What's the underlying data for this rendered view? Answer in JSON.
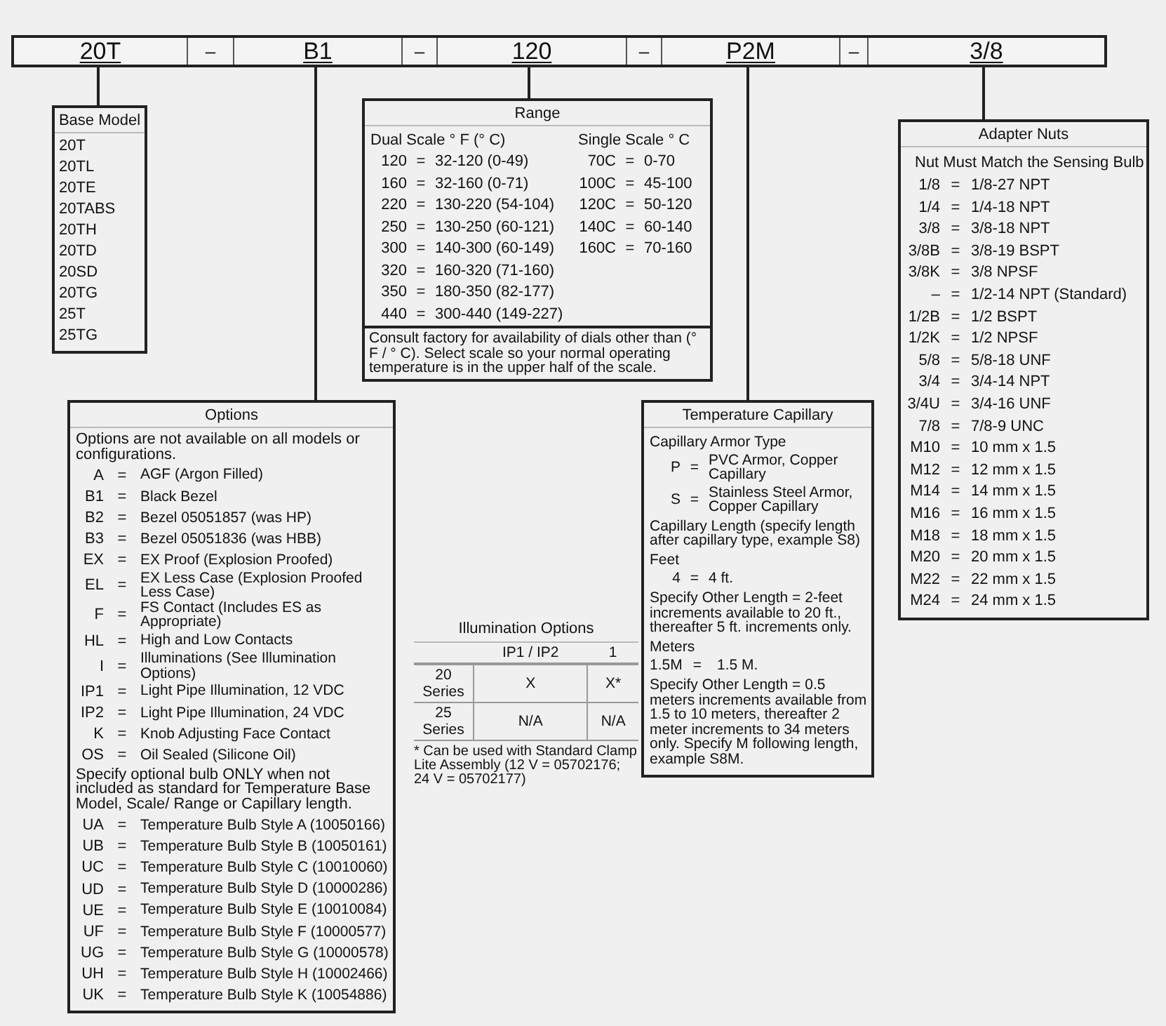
{
  "part_number": {
    "segments": [
      {
        "kind": "code",
        "text": "20T"
      },
      {
        "kind": "separator",
        "text": "–"
      },
      {
        "kind": "code",
        "text": "B1"
      },
      {
        "kind": "separator",
        "text": "–"
      },
      {
        "kind": "code",
        "text": "120"
      },
      {
        "kind": "separator",
        "text": "–"
      },
      {
        "kind": "code",
        "text": "P2M"
      },
      {
        "kind": "separator",
        "text": "–"
      },
      {
        "kind": "code",
        "text": "3/8"
      }
    ]
  },
  "base_model": {
    "title": "Base Model",
    "items": [
      "20T",
      "20TL",
      "20TE",
      "20TABS",
      "20TH",
      "20TD",
      "20SD",
      "20TG",
      "25T",
      "25TG"
    ]
  },
  "range": {
    "title": "Range",
    "dual_scale": {
      "heading": "Dual Scale ° F (° C)",
      "rows": [
        {
          "code": "120",
          "eq": "=",
          "value": "32-120 (0-49)"
        },
        {
          "code": "160",
          "eq": "=",
          "value": "32-160 (0-71)"
        },
        {
          "code": "220",
          "eq": "=",
          "value": "130-220 (54-104)"
        },
        {
          "code": "250",
          "eq": "=",
          "value": "130-250 (60-121)"
        },
        {
          "code": "300",
          "eq": "=",
          "value": "140-300 (60-149)"
        },
        {
          "code": "320",
          "eq": "=",
          "value": "160-320 (71-160)"
        },
        {
          "code": "350",
          "eq": "=",
          "value": "180-350 (82-177)"
        },
        {
          "code": "440",
          "eq": "=",
          "value": "300-440 (149-227)"
        }
      ]
    },
    "single_scale": {
      "heading": "Single Scale ° C",
      "rows": [
        {
          "code": "70C",
          "eq": "=",
          "value": "0-70"
        },
        {
          "code": "100C",
          "eq": "=",
          "value": "45-100"
        },
        {
          "code": "120C",
          "eq": "=",
          "value": "50-120"
        },
        {
          "code": "140C",
          "eq": "=",
          "value": "60-140"
        },
        {
          "code": "160C",
          "eq": "=",
          "value": "70-160"
        }
      ]
    },
    "note": "Consult factory for availability of dials other than (° F / ° C). Select scale so your normal operating temperature is in the upper half of the scale."
  },
  "options": {
    "title": "Options",
    "entries": [
      {
        "kind": "note",
        "text": "Options are not available on all models or configurations."
      },
      {
        "kind": "row",
        "code": "A",
        "eq": "=",
        "value": "AGF (Argon Filled)"
      },
      {
        "kind": "row",
        "code": "B1",
        "eq": "=",
        "value": "Black Bezel"
      },
      {
        "kind": "row",
        "code": "B2",
        "eq": "=",
        "value": "Bezel 05051857 (was HP)"
      },
      {
        "kind": "row",
        "code": "B3",
        "eq": "=",
        "value": "Bezel 05051836 (was HBB)"
      },
      {
        "kind": "row",
        "code": "EX",
        "eq": "=",
        "value": "EX Proof (Explosion Proofed)"
      },
      {
        "kind": "row",
        "code": "EL",
        "eq": "=",
        "value": "EX Less Case (Explosion Proofed Less Case)"
      },
      {
        "kind": "row",
        "code": "F",
        "eq": "=",
        "value": "FS Contact (Includes ES as Appropriate)"
      },
      {
        "kind": "row",
        "code": "HL",
        "eq": "=",
        "value": "High and Low Contacts"
      },
      {
        "kind": "row",
        "code": "I",
        "eq": "=",
        "value": "Illuminations (See Illumination Options)"
      },
      {
        "kind": "row",
        "code": "IP1",
        "eq": "=",
        "value": "Light Pipe Illumination, 12 VDC"
      },
      {
        "kind": "row",
        "code": "IP2",
        "eq": "=",
        "value": "Light Pipe Illumination, 24 VDC"
      },
      {
        "kind": "row",
        "code": "K",
        "eq": "=",
        "value": "Knob Adjusting Face Contact"
      },
      {
        "kind": "row",
        "code": "OS",
        "eq": "=",
        "value": "Oil Sealed (Silicone Oil)"
      },
      {
        "kind": "note",
        "text": "Specify optional bulb ONLY when not included as standard for Temperature Base Model, Scale/ Range or Capillary length."
      },
      {
        "kind": "row",
        "code": "UA",
        "eq": "=",
        "value": "Temperature Bulb Style A (10050166)"
      },
      {
        "kind": "row",
        "code": "UB",
        "eq": "=",
        "value": "Temperature Bulb Style B (10050161)"
      },
      {
        "kind": "row",
        "code": "UC",
        "eq": "=",
        "value": "Temperature Bulb Style C (10010060)"
      },
      {
        "kind": "row",
        "code": "UD",
        "eq": "=",
        "value": "Temperature Bulb Style D (10000286)"
      },
      {
        "kind": "row",
        "code": "UE",
        "eq": "=",
        "value": "Temperature Bulb Style E (10010084)"
      },
      {
        "kind": "row",
        "code": "UF",
        "eq": "=",
        "value": "Temperature Bulb Style F (10000577)"
      },
      {
        "kind": "row",
        "code": "UG",
        "eq": "=",
        "value": "Temperature Bulb Style G (10000578)"
      },
      {
        "kind": "row",
        "code": "UH",
        "eq": "=",
        "value": "Temperature Bulb Style H (10002466)"
      },
      {
        "kind": "row",
        "code": "UK",
        "eq": "=",
        "value": "Temperature Bulb Style K (10054886)"
      }
    ]
  },
  "illumination_options": {
    "title": "Illumination Options",
    "columns": [
      "IP1 / IP2",
      "1"
    ],
    "rows": [
      {
        "label": "20 Series",
        "cells": [
          "X",
          "X*"
        ]
      },
      {
        "label": "25 Series",
        "cells": [
          "N/A",
          "N/A"
        ]
      }
    ],
    "footnote": "* Can be used with Standard Clamp Lite Assembly (12 V = 05702176; 24 V = 05702177)"
  },
  "temperature_capillary": {
    "title": "Temperature Capillary",
    "entries": [
      {
        "kind": "heading",
        "text": "Capillary Armor Type"
      },
      {
        "kind": "row",
        "code": "P",
        "eq": "=",
        "value": "PVC Armor, Copper Capillary"
      },
      {
        "kind": "row",
        "code": "S",
        "eq": "=",
        "value": "Stainless Steel Armor, Copper Capillary"
      },
      {
        "kind": "heading",
        "text": "Capillary Length (specify length after capillary type, example S8)"
      },
      {
        "kind": "heading",
        "text": "Feet"
      },
      {
        "kind": "row",
        "code": "4",
        "eq": "=",
        "value": "4 ft."
      },
      {
        "kind": "note",
        "text": "Specify Other Length = 2-feet increments available to 20 ft., thereafter 5 ft. increments only."
      },
      {
        "kind": "heading",
        "text": "Meters"
      },
      {
        "kind": "wide_row",
        "code": "1.5M",
        "eq": "=",
        "value": "1.5 M."
      },
      {
        "kind": "note",
        "text": "Specify Other Length = 0.5 meters increments available from 1.5 to 10 meters, thereafter 2 meter increments to 34 meters only. Specify M following length, example S8M."
      }
    ]
  },
  "adapter_nuts": {
    "title": "Adapter Nuts",
    "subtitle": "Nut Must Match the Sensing Bulb",
    "rows": [
      {
        "code": "1/8",
        "eq": "=",
        "value": "1/8-27 NPT"
      },
      {
        "code": "1/4",
        "eq": "=",
        "value": "1/4-18 NPT"
      },
      {
        "code": "3/8",
        "eq": "=",
        "value": "3/8-18 NPT"
      },
      {
        "code": "3/8B",
        "eq": "=",
        "value": "3/8-19 BSPT"
      },
      {
        "code": "3/8K",
        "eq": "=",
        "value": "3/8 NPSF"
      },
      {
        "code": "–",
        "eq": "=",
        "value": "1/2-14 NPT (Standard)"
      },
      {
        "code": "1/2B",
        "eq": "=",
        "value": "1/2 BSPT"
      },
      {
        "code": "1/2K",
        "eq": "=",
        "value": "1/2 NPSF"
      },
      {
        "code": "5/8",
        "eq": "=",
        "value": "5/8-18 UNF"
      },
      {
        "code": "3/4",
        "eq": "=",
        "value": "3/4-14 NPT"
      },
      {
        "code": "3/4U",
        "eq": "=",
        "value": "3/4-16 UNF"
      },
      {
        "code": "7/8",
        "eq": "=",
        "value": "7/8-9 UNC"
      },
      {
        "code": "M10",
        "eq": "=",
        "value": "10 mm x 1.5"
      },
      {
        "code": "M12",
        "eq": "=",
        "value": "12 mm x 1.5"
      },
      {
        "code": "M14",
        "eq": "=",
        "value": "14 mm x 1.5"
      },
      {
        "code": "M16",
        "eq": "=",
        "value": "16 mm x 1.5"
      },
      {
        "code": "M18",
        "eq": "=",
        "value": "18 mm x 1.5"
      },
      {
        "code": "M20",
        "eq": "=",
        "value": "20 mm x 1.5"
      },
      {
        "code": "M22",
        "eq": "=",
        "value": "22 mm x 1.5"
      },
      {
        "code": "M24",
        "eq": "=",
        "value": "24 mm x 1.5"
      }
    ]
  }
}
